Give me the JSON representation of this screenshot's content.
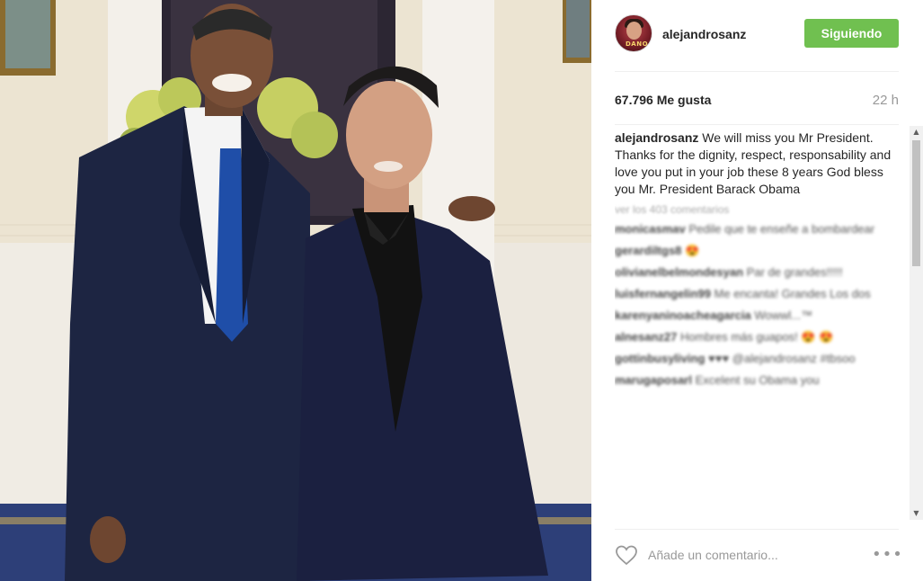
{
  "post": {
    "username": "alejandrosanz",
    "follow_label": "Siguiendo",
    "avatar_text": "DANO",
    "likes": "67.796 Me gusta",
    "time": "22 h",
    "caption": "We will miss you Mr President. Thanks for the dignity, respect, responsability and love you put in your job these 8 years God bless you Mr. President Barack Obama",
    "view_all_comments": "ver los 403 comentarios",
    "comments": [
      {
        "user": "monicasmav",
        "text": "Pedile que te enseñe a bombardear"
      },
      {
        "user": "gerardiltgs8",
        "text": "😍"
      },
      {
        "user": "olivianelbelmondesyan",
        "text": "Par de grandes!!!!!"
      },
      {
        "user": "luisfernangelin99",
        "text": "Me encanta! Grandes Los dos"
      },
      {
        "user": "karenyaninoacheagarcia",
        "text": "Wowwl...™"
      },
      {
        "user": "alnesanz27",
        "text": "Hombres más guapos! 😍 😍"
      },
      {
        "user": "gottinbusyliving",
        "text": "♥♥♥ @alejandrosanz #tbsoo"
      },
      {
        "user": "marugaposarl",
        "text": "Excelent su Obama you"
      }
    ],
    "comment_placeholder": "Añade un comentario...",
    "more_icon": "•••"
  },
  "colors": {
    "follow_green": "#70c050",
    "text": "#262626",
    "muted": "#999999"
  }
}
